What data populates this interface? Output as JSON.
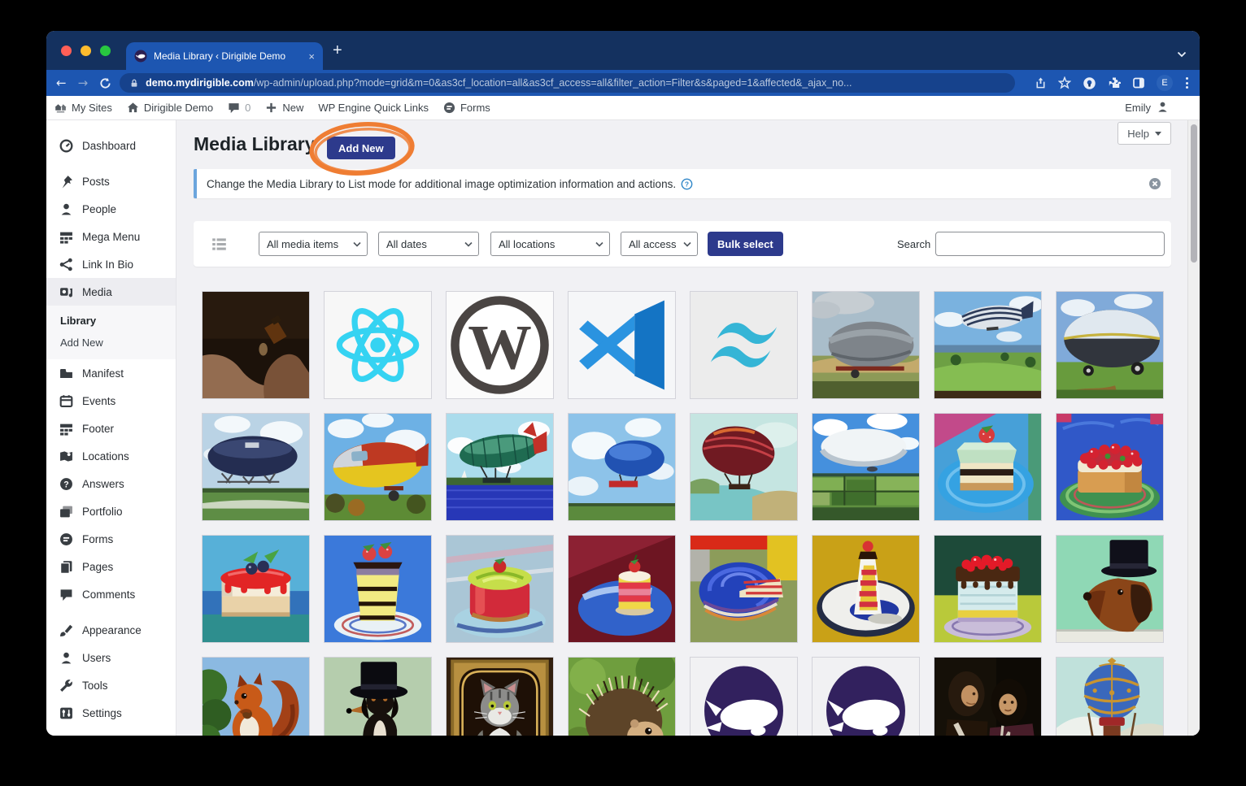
{
  "browser": {
    "tab_title": "Media Library ‹ Dirigible Demo",
    "tab_close": "×",
    "new_tab": "+",
    "url_domain": "demo.mydirigible.com",
    "url_path": "/wp-admin/upload.php?mode=grid&m=0&as3cf_location=all&as3cf_access=all&filter_action=Filter&s&paged=1&affected&_ajax_no...",
    "profile_initial": "E"
  },
  "admin_bar": {
    "items": [
      {
        "icon": "my-sites-icon",
        "label": "My Sites"
      },
      {
        "icon": "home-icon",
        "label": "Dirigible Demo"
      },
      {
        "icon": "comment-icon",
        "label": "0",
        "muted": true
      },
      {
        "icon": "plus-icon",
        "label": "New"
      },
      {
        "label": "WP Engine Quick Links"
      },
      {
        "icon": "forms-icon",
        "label": "Forms"
      }
    ],
    "user": {
      "label": "Emily",
      "icon": "user-icon"
    }
  },
  "sidebar": {
    "items": [
      {
        "label": "Dashboard",
        "icon": "dashboard-icon"
      },
      {
        "kind": "gap"
      },
      {
        "label": "Posts",
        "icon": "pin-icon"
      },
      {
        "label": "People",
        "icon": "user-icon"
      },
      {
        "label": "Mega Menu",
        "icon": "grid-icon"
      },
      {
        "label": "Link In Bio",
        "icon": "share-icon"
      },
      {
        "label": "Media",
        "icon": "media-icon",
        "active": true
      },
      {
        "label": "Library",
        "kind": "sub",
        "current": true
      },
      {
        "label": "Add New",
        "kind": "sub"
      },
      {
        "label": "Manifest",
        "icon": "folder-icon"
      },
      {
        "label": "Events",
        "icon": "calendar-icon"
      },
      {
        "label": "Footer",
        "icon": "grid-icon"
      },
      {
        "label": "Locations",
        "icon": "map-icon"
      },
      {
        "label": "Answers",
        "icon": "question-icon"
      },
      {
        "label": "Portfolio",
        "icon": "portfolio-icon"
      },
      {
        "label": "Forms",
        "icon": "forms-icon"
      },
      {
        "label": "Pages",
        "icon": "pages-icon"
      },
      {
        "label": "Comments",
        "icon": "comment-icon"
      },
      {
        "kind": "gap"
      },
      {
        "label": "Appearance",
        "icon": "brush-icon"
      },
      {
        "label": "Users",
        "icon": "user-icon"
      },
      {
        "label": "Tools",
        "icon": "wrench-icon"
      },
      {
        "label": "Settings",
        "icon": "settings-icon"
      }
    ]
  },
  "page": {
    "title": "Media Library",
    "add_new_label": "Add New",
    "help_label": "Help",
    "notice_text": "Change the Media Library to List mode for additional image optimization information and actions."
  },
  "filters": {
    "dropdowns": [
      {
        "name": "media-type-filter",
        "value": "All media items"
      },
      {
        "name": "date-filter",
        "value": "All dates"
      },
      {
        "name": "location-filter",
        "value": "All locations"
      },
      {
        "name": "access-filter",
        "value": "All access"
      }
    ],
    "bulk_select_label": "Bulk select",
    "search_label": "Search",
    "search_value": ""
  },
  "media_grid": {
    "items": [
      {
        "kind": "hands-photo",
        "label": "hands pouring small bottle photo"
      },
      {
        "kind": "react-logo",
        "label": "React logo"
      },
      {
        "kind": "wordpress-logo",
        "label": "WordPress logo"
      },
      {
        "kind": "vscode-logo",
        "label": "VS Code logo"
      },
      {
        "kind": "tailwind-logo",
        "label": "Tailwind CSS logo"
      },
      {
        "kind": "airship-cloud-field",
        "label": "gray airship in field painting"
      },
      {
        "kind": "airship-striped-sky",
        "label": "striped zeppelin over countryside painting"
      },
      {
        "kind": "airship-ground-large",
        "label": "large zeppelin on field painting"
      },
      {
        "kind": "airship-navy-field",
        "label": "navy zeppelin over field painting"
      },
      {
        "kind": "airship-red-yellow",
        "label": "red and yellow airship painting"
      },
      {
        "kind": "airship-green-water",
        "label": "green airship over water painting"
      },
      {
        "kind": "airship-blue-banner",
        "label": "blue blimp with banner painting"
      },
      {
        "kind": "airship-maroon-coast",
        "label": "dark red blimp over coast painting"
      },
      {
        "kind": "airship-white-fields",
        "label": "white zeppelin over fields painting"
      },
      {
        "kind": "cake-slice-strawberry-blue-plate",
        "label": "cake slice with strawberry on blue plate"
      },
      {
        "kind": "cake-cherries-green-plate",
        "label": "cherry topped cake on green plate"
      },
      {
        "kind": "cake-red-glaze-blueberries",
        "label": "red glaze cake with blueberries"
      },
      {
        "kind": "cake-yellow-slice-strawberries",
        "label": "yellow layer slice with strawberries"
      },
      {
        "kind": "cake-red-green-swirl",
        "label": "red cake with green swirl top"
      },
      {
        "kind": "cake-mini-striped",
        "label": "striped mini cake on blue plate"
      },
      {
        "kind": "cake-blue-spiral-cut",
        "label": "blue spiral cake with cut slice"
      },
      {
        "kind": "cake-slice-plate",
        "label": "layer cake slice on plate"
      },
      {
        "kind": "cake-chocolate-drip-red",
        "label": "chocolate drip cake with red topping"
      },
      {
        "kind": "dog-top-hat-green",
        "label": "dog head with top hat painting"
      },
      {
        "kind": "squirrel-painting",
        "label": "squirrel painting"
      },
      {
        "kind": "dog-top-hat-standing",
        "label": "dog wearing top hat painting"
      },
      {
        "kind": "cat-portrait-frame",
        "label": "cat portrait in gold frame"
      },
      {
        "kind": "hedgehog-photo",
        "label": "hedgehog photo"
      },
      {
        "kind": "dirigible-logo",
        "label": "purple dirigible logo"
      },
      {
        "kind": "dirigible-logo",
        "label": "purple dirigible logo"
      },
      {
        "kind": "band-photo-vintage",
        "label": "vintage band photo"
      },
      {
        "kind": "balloon-montgolfier",
        "label": "blue and gold hot air balloon painting"
      }
    ]
  },
  "colors": {
    "accent_navy": "#2d3a8c",
    "annotation_orange": "#ef7d33",
    "chrome_blue": "#1d56b1",
    "chrome_dark": "#14315f",
    "notice_accent": "#6ba5dd",
    "logo_purple": "#32215e"
  }
}
